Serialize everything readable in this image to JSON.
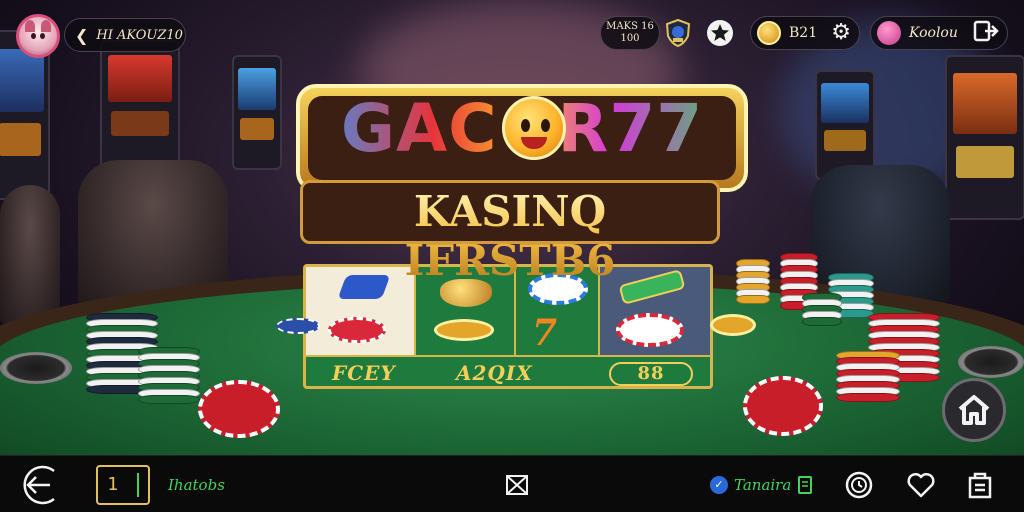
{
  "top_bar": {
    "back_label": "HI AKOUZ10",
    "level_line1": "MAKS 16",
    "level_line2": "100",
    "coins_value": "B21",
    "user_name": "Koolou"
  },
  "logo": {
    "title_left": "GAC",
    "title_right": "R77",
    "subtitle": "KASINQ IFRSTB6"
  },
  "board": {
    "label_left": "FCEY",
    "label_mid": "A2QIX",
    "label_right": "88"
  },
  "bottom_bar": {
    "counter_value": "1",
    "left_label": "Ihatobs",
    "right_label": "Tanaira"
  },
  "colors": {
    "felt": "#1e6b38",
    "gold": "#f2cf59",
    "accent_green": "#3fd45a"
  }
}
